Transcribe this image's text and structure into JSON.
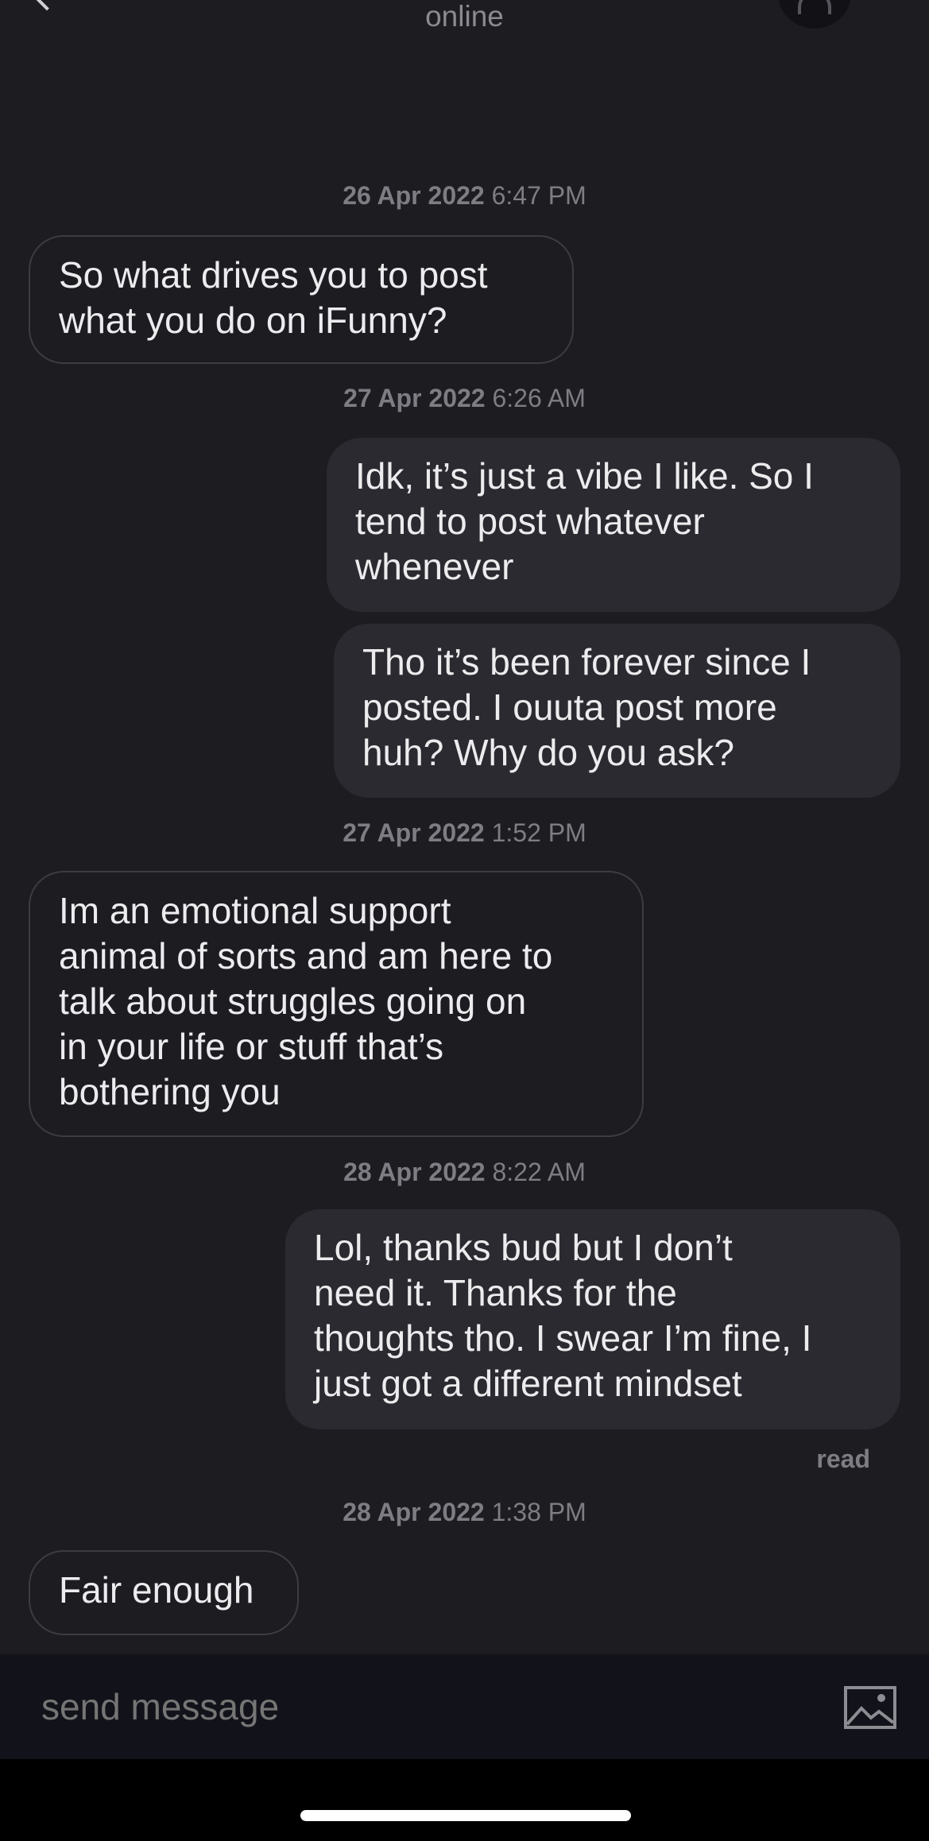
{
  "header": {
    "status": "online"
  },
  "messages": [
    {
      "type": "timestamp",
      "date": "26 Apr 2022",
      "time": "6:47 PM"
    },
    {
      "type": "incoming",
      "text": "So what drives you to post\nwhat you do on iFunny?"
    },
    {
      "type": "timestamp",
      "date": "27 Apr 2022",
      "time": "6:26 AM"
    },
    {
      "type": "outgoing",
      "text": "Idk, it’s just a vibe I like. So I\ntend to post whatever\nwhenever"
    },
    {
      "type": "outgoing",
      "text": "Tho it’s been forever since I\nposted. I ouuta post more\nhuh? Why do you ask?"
    },
    {
      "type": "timestamp",
      "date": "27 Apr 2022",
      "time": "1:52 PM"
    },
    {
      "type": "incoming",
      "text": "Im an emotional support\nanimal of sorts and am here to\ntalk about struggles going on\nin your life or stuff that’s\nbothering you"
    },
    {
      "type": "timestamp",
      "date": "28 Apr 2022",
      "time": "8:22 AM"
    },
    {
      "type": "outgoing",
      "text": "Lol, thanks bud but I don’t\nneed it. Thanks for the\nthoughts tho. I swear I’m fine, I\njust got a different mindset"
    },
    {
      "type": "timestamp",
      "date": "28 Apr 2022",
      "time": "1:38 PM"
    },
    {
      "type": "incoming",
      "text": "Fair enough"
    }
  ],
  "read_receipt": "read",
  "composer": {
    "placeholder": "send message",
    "image_icon": "image-icon"
  },
  "colors": {
    "background": "#1c1c21",
    "outgoing_bubble": "#2a2a30",
    "incoming_border": "#3c3c43",
    "composer_bg": "#12121a"
  }
}
